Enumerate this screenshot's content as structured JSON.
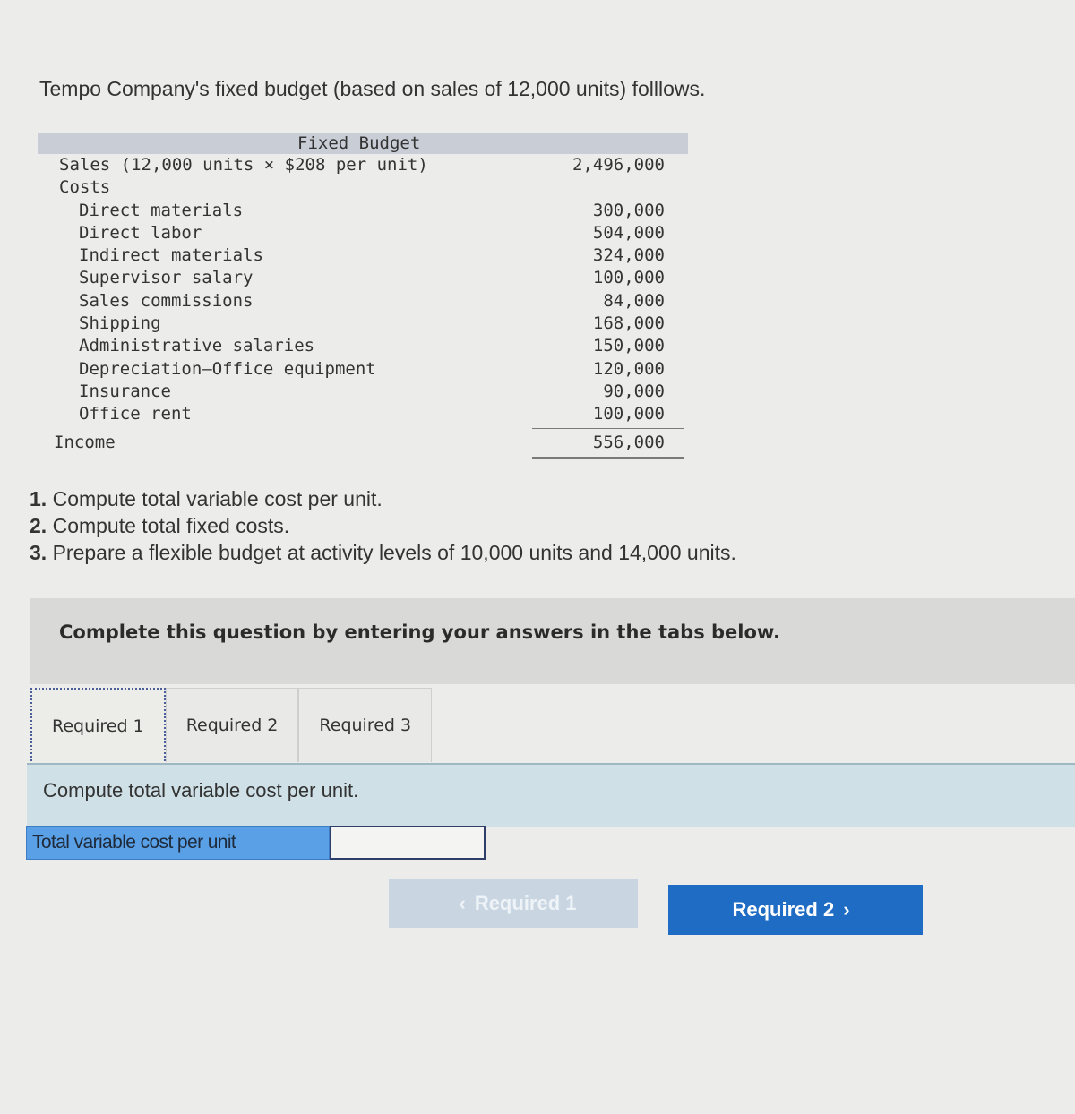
{
  "intro": "Tempo Company's fixed budget (based on sales of 12,000 units) folllows.",
  "budget": {
    "header": "Fixed Budget",
    "sales_label": "Sales (12,000 units × $208 per unit)",
    "sales_value": "2,496,000",
    "costs_label": "Costs",
    "cost_items": [
      {
        "label": "Direct materials",
        "value": "300,000"
      },
      {
        "label": "Direct labor",
        "value": "504,000"
      },
      {
        "label": "Indirect materials",
        "value": "324,000"
      },
      {
        "label": "Supervisor salary",
        "value": "100,000"
      },
      {
        "label": "Sales commissions",
        "value": "84,000"
      },
      {
        "label": "Shipping",
        "value": "168,000"
      },
      {
        "label": "Administrative salaries",
        "value": "150,000"
      },
      {
        "label": "Depreciation—Office equipment",
        "value": "120,000"
      },
      {
        "label": "Insurance",
        "value": "90,000"
      },
      {
        "label": "Office rent",
        "value": "100,000"
      }
    ],
    "income_label": "Income",
    "income_value": "556,000"
  },
  "questions": [
    {
      "num": "1.",
      "text": " Compute total variable cost per unit."
    },
    {
      "num": "2.",
      "text": " Compute total fixed costs."
    },
    {
      "num": "3.",
      "text": " Prepare a flexible budget at activity levels of 10,000 units and 14,000 units."
    }
  ],
  "instruction": "Complete this question by entering your answers in the tabs below.",
  "tabs": [
    {
      "label": "Required 1",
      "active": true
    },
    {
      "label": "Required 2",
      "active": false
    },
    {
      "label": "Required 3",
      "active": false
    }
  ],
  "panel": {
    "heading": "Compute total variable cost per unit.",
    "answer_label": "Total variable cost per unit",
    "answer_value": ""
  },
  "nav": {
    "prev_label": "Required 1",
    "next_label": "Required 2",
    "prev_icon": "chevron-left-icon",
    "next_icon": "chevron-right-icon"
  }
}
